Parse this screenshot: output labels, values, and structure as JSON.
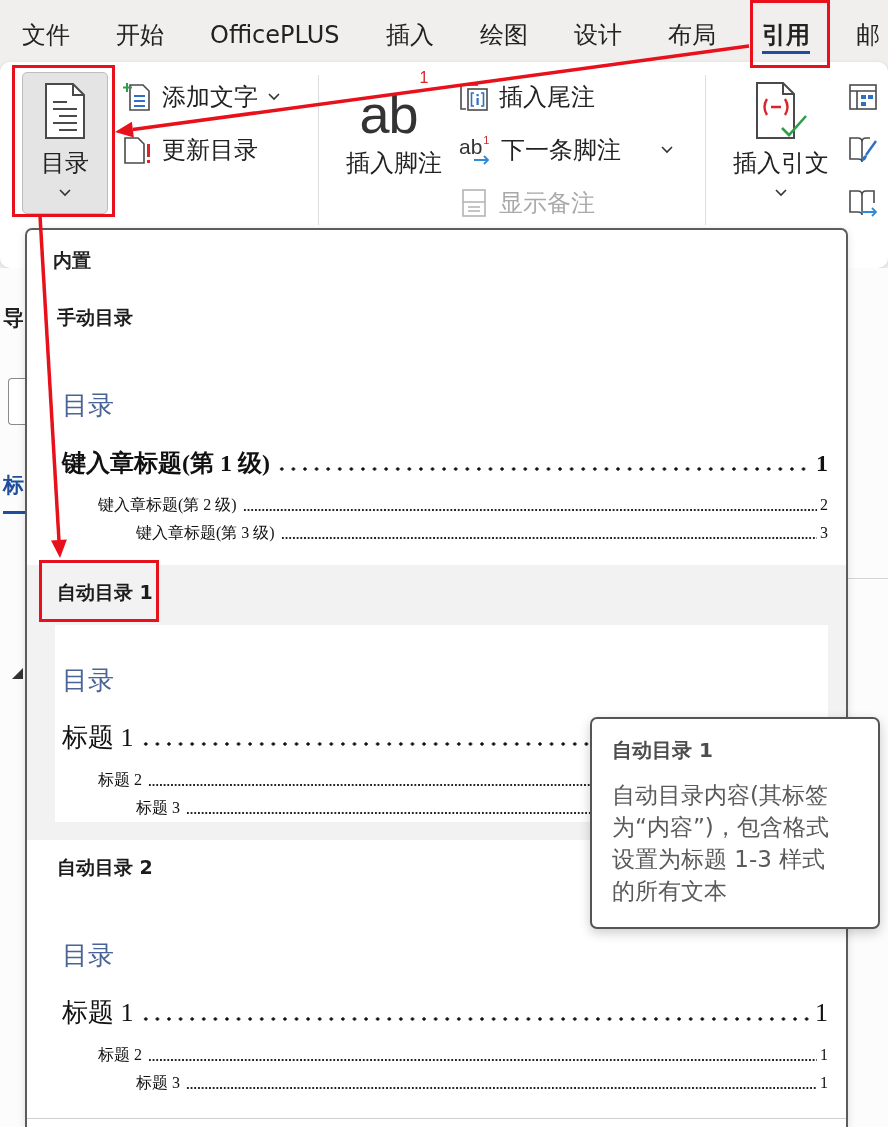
{
  "tabs": [
    {
      "label": "文件",
      "selected": false,
      "highlighted": false
    },
    {
      "label": "开始",
      "selected": false,
      "highlighted": false
    },
    {
      "label": "OfficePLUS",
      "selected": false,
      "highlighted": false
    },
    {
      "label": "插入",
      "selected": false,
      "highlighted": false
    },
    {
      "label": "绘图",
      "selected": false,
      "highlighted": false
    },
    {
      "label": "设计",
      "selected": false,
      "highlighted": false
    },
    {
      "label": "布局",
      "selected": false,
      "highlighted": false
    },
    {
      "label": "引用",
      "selected": true,
      "highlighted": true
    },
    {
      "label": "邮",
      "selected": false,
      "highlighted": false
    }
  ],
  "ribbon": {
    "groups": [
      {
        "large": {
          "kind": "toc",
          "label": "目录",
          "dropdown": true,
          "pressed": true,
          "highlighted": true
        },
        "small": [
          {
            "kind": "addtext",
            "label": "添加文字",
            "dropdown": true,
            "disabled": false
          },
          {
            "kind": "update",
            "label": "更新目录",
            "dropdown": false,
            "disabled": false
          }
        ]
      },
      {
        "large": {
          "kind": "footnote",
          "label": "插入脚注",
          "glyph": "ab",
          "superscript": "1",
          "dropdown": false,
          "pressed": false,
          "highlighted": false
        },
        "small": [
          {
            "kind": "endnote",
            "label": "插入尾注",
            "dropdown": false,
            "disabled": false
          },
          {
            "kind": "nextnote",
            "label": "下一条脚注",
            "glyph": "ab",
            "superscript": "1",
            "dropdown": true,
            "disabled": false
          },
          {
            "kind": "notes",
            "label": "显示备注",
            "dropdown": false,
            "disabled": true
          }
        ]
      },
      {
        "large": {
          "kind": "citation",
          "label": "插入引文",
          "dropdown": true,
          "pressed": false,
          "highlighted": false
        },
        "small": [
          {
            "kind": "sources",
            "dropdown": false,
            "disabled": false
          },
          {
            "kind": "style",
            "dropdown": false,
            "disabled": false
          },
          {
            "kind": "bibliography",
            "dropdown": false,
            "disabled": false
          }
        ]
      }
    ]
  },
  "nav_pane": {
    "title": "导",
    "search_field": true,
    "tabs": [
      {
        "label": "标",
        "selected": true
      }
    ],
    "outline_expanded": true
  },
  "toc_menu": {
    "section": "内置",
    "items": [
      {
        "kind": "manual",
        "label": "手动目录",
        "selected": false,
        "highlighted": false,
        "preview": {
          "heading": "目录",
          "entries": [
            {
              "text": "键入章标题(第 1 级)",
              "page": "1",
              "children": [
                {
                  "text": "键入章标题(第 2 级)",
                  "page": "2",
                  "children": [
                    {
                      "text": "键入章标题(第 3 级)",
                      "page": "3"
                    }
                  ]
                }
              ]
            }
          ]
        }
      },
      {
        "kind": "auto",
        "label": "自动目录 1",
        "selected": true,
        "highlighted": true,
        "preview": {
          "heading": "目录",
          "entries": [
            {
              "text": "标题 1",
              "children": [
                {
                  "text": "标题 2",
                  "children": [
                    {
                      "text": "标题 3"
                    }
                  ]
                }
              ]
            }
          ]
        }
      },
      {
        "kind": "auto",
        "label": "自动目录 2",
        "selected": false,
        "highlighted": false,
        "preview": {
          "heading": "目录",
          "entries": [
            {
              "text": "标题 1",
              "page": "1",
              "children": [
                {
                  "text": "标题 2",
                  "page": "1",
                  "children": [
                    {
                      "text": "标题 3",
                      "page": "1"
                    }
                  ]
                }
              ]
            }
          ]
        }
      }
    ]
  },
  "tooltip": {
    "title": "自动目录 1",
    "text": "自动目录内容(其标签为“内容”)，包含格式设置为标题 1-3 样式的所有文本"
  },
  "annotation_arrows": true
}
